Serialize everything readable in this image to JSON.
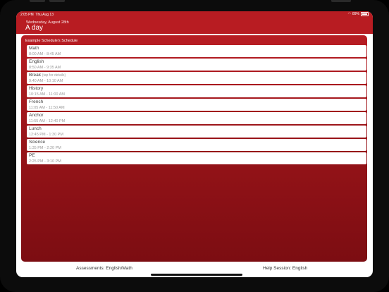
{
  "status": {
    "time": "2:05 PM",
    "date": "Thu Aug 13",
    "battery": "89%"
  },
  "header": {
    "date": "Wednesday, August 28th",
    "title": "A day"
  },
  "schedule": {
    "title": "Example Schedule's Schedule",
    "items": [
      {
        "name": "Math",
        "note": "",
        "time": "8:00 AM - 8:45 AM"
      },
      {
        "name": "English",
        "note": "",
        "time": "8:50 AM - 9:35 AM"
      },
      {
        "name": "Break",
        "note": "(tap for details)",
        "time": "9:40 AM - 10:10 AM"
      },
      {
        "name": "History",
        "note": "",
        "time": "10:15 AM - 11:00 AM"
      },
      {
        "name": "French",
        "note": "",
        "time": "11:05 AM - 11:50 AM"
      },
      {
        "name": "Anchor",
        "note": "",
        "time": "11:55 AM - 12:40 PM"
      },
      {
        "name": "Lunch",
        "note": "",
        "time": "12:45 PM - 1:30 PM"
      },
      {
        "name": "Science",
        "note": "",
        "time": "1:35 PM - 2:20 PM"
      },
      {
        "name": "PE",
        "note": "",
        "time": "2:25 PM - 3:10 PM"
      }
    ]
  },
  "footer": {
    "left": "Assessments: English/Math",
    "right": "Help Session: English"
  },
  "colors": {
    "accent": "#b81c22",
    "accent_dark": "#7c0d12"
  }
}
